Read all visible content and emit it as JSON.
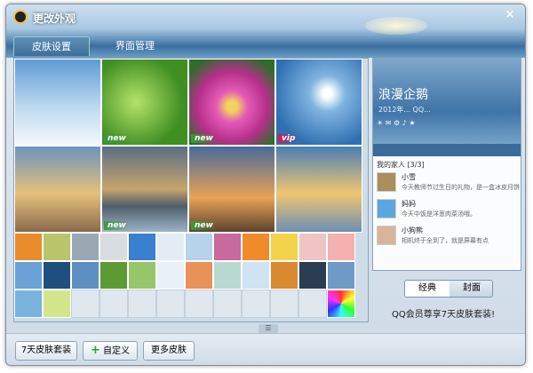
{
  "window": {
    "title": "更改外观",
    "close_symbol": "✕"
  },
  "tabs": [
    {
      "label": "皮肤设置",
      "active": true
    },
    {
      "label": "界面管理",
      "active": false
    }
  ],
  "skins": {
    "large": [
      {
        "badge": ""
      },
      {
        "badge": "new"
      },
      {
        "badge": "new"
      },
      {
        "badge": "vip"
      },
      {
        "badge": ""
      },
      {
        "badge": "new"
      },
      {
        "badge": "new"
      },
      {
        "badge": ""
      }
    ]
  },
  "preview": {
    "nickname": "浪漫企鹅",
    "info": "2012年... QQ...",
    "group": "我的家人 [3/3]",
    "contacts": [
      {
        "name": "小雪",
        "message": "今天教师节过生日的礼物，是一盒冰皮月饼"
      },
      {
        "name": "妈妈",
        "message": "今天中饭是洋葱肉菜汤哦。"
      },
      {
        "name": "小狗熊",
        "message": "相机终于全到了，就是屏幕有点"
      }
    ]
  },
  "mode": {
    "classic": "经典",
    "cover": "封面"
  },
  "vip_promo": "QQ会员尊享7天皮肤套装!",
  "bottom": {
    "btn_7day": "7天皮肤套装",
    "btn_custom": "自定义",
    "btn_more": "更多皮肤",
    "handle": "☰"
  }
}
